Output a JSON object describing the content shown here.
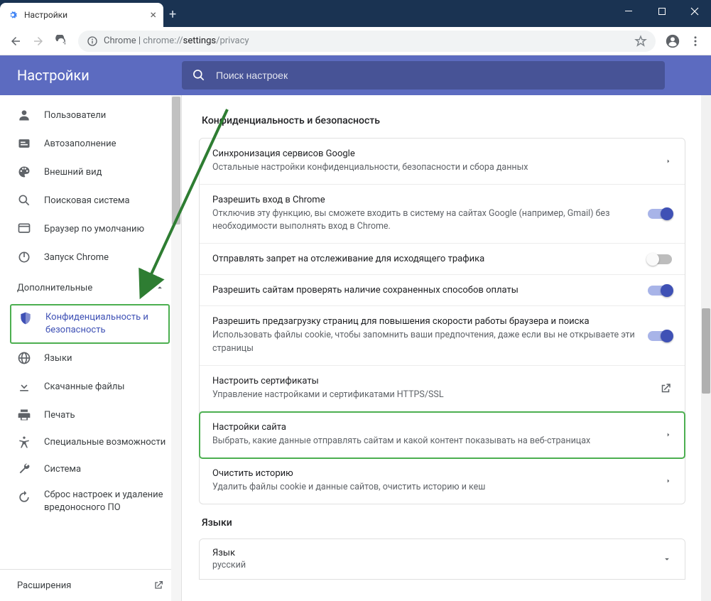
{
  "window": {
    "tab_title": "Настройки"
  },
  "omnibox": {
    "prefix": "Chrome",
    "separator": " | ",
    "protocol": "chrome://",
    "host": "settings",
    "path": "/privacy"
  },
  "header": {
    "title": "Настройки",
    "search_placeholder": "Поиск настроек"
  },
  "sidebar": {
    "items": [
      {
        "icon": "person",
        "label": "Пользователи"
      },
      {
        "icon": "autofill",
        "label": "Автозаполнение"
      },
      {
        "icon": "palette",
        "label": "Внешний вид"
      },
      {
        "icon": "search",
        "label": "Поисковая система"
      },
      {
        "icon": "browser",
        "label": "Браузер по умолчанию"
      },
      {
        "icon": "power",
        "label": "Запуск Chrome"
      }
    ],
    "advanced_label": "Дополнительные",
    "advanced_items": [
      {
        "icon": "shield",
        "label": "Конфиденциальность и безопасность",
        "active": true
      },
      {
        "icon": "globe",
        "label": "Языки"
      },
      {
        "icon": "download",
        "label": "Скачанные файлы"
      },
      {
        "icon": "print",
        "label": "Печать"
      },
      {
        "icon": "accessibility",
        "label": "Специальные возможности"
      },
      {
        "icon": "wrench",
        "label": "Система"
      },
      {
        "icon": "restore",
        "label": "Сброс настроек и удаление вредоносного ПО"
      }
    ],
    "extensions_label": "Расширения"
  },
  "main": {
    "section_title": "Конфиденциальность и безопасность",
    "rows": [
      {
        "title": "Синхронизация сервисов Google",
        "subtitle": "Остальные настройки конфиденциальности, безопасности и сбора данных",
        "control": "chevron"
      },
      {
        "title": "Разрешить вход в Chrome",
        "subtitle": "Отключив эту функцию, вы сможете входить в систему на сайтах Google (например, Gmail) без необходимости выполнять вход в Chrome.",
        "control": "toggle_on"
      },
      {
        "title": "Отправлять запрет на отслеживание для исходящего трафика",
        "subtitle": "",
        "control": "toggle_off"
      },
      {
        "title": "Разрешить сайтам проверять наличие сохраненных способов оплаты",
        "subtitle": "",
        "control": "toggle_on"
      },
      {
        "title": "Разрешить предзагрузку страниц для повышения скорости работы браузера и поиска",
        "subtitle": "Использовать файлы cookie, чтобы запомнить ваши предпочтения, даже если вы не открываете эти страницы",
        "control": "toggle_on"
      },
      {
        "title": "Настроить сертификаты",
        "subtitle": "Управление настройками и сертификатами HTTPS/SSL",
        "control": "external"
      },
      {
        "title": "Настройки сайта",
        "subtitle": "Выбрать, какие данные отправлять сайтам и какой контент показывать на веб-страницах",
        "control": "chevron",
        "highlight": true
      },
      {
        "title": "Очистить историю",
        "subtitle": "Удалить файлы cookie и данные сайтов, очистить историю и кеш",
        "control": "chevron"
      }
    ],
    "languages_title": "Языки",
    "language_row": {
      "title": "Язык",
      "subtitle": "русский"
    }
  }
}
